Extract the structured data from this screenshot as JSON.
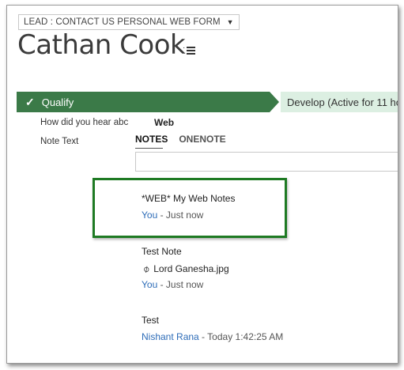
{
  "header": {
    "form_selector": "LEAD : CONTACT US PERSONAL WEB FORM",
    "record_title": "Cathan Cook"
  },
  "process_bar": {
    "active_stage": "Qualify",
    "next_stage": "Develop (Active for 11 ho"
  },
  "fields": {
    "how_heard_label": "How did you hear abc",
    "how_heard_value": "Web",
    "note_text_label": "Note Text"
  },
  "tabs": {
    "notes": "NOTES",
    "onenote": "ONENOTE"
  },
  "notes": [
    {
      "title": "*WEB* My Web Notes",
      "author": "You",
      "separator": " - ",
      "time": "Just now"
    },
    {
      "title": "Test Note",
      "attachment": "Lord Ganesha.jpg",
      "author": "You",
      "separator": " - ",
      "time": "Just now"
    },
    {
      "title": "Test",
      "author": "Nishant Rana",
      "separator": " - ",
      "time": "Today 1:42:25 AM"
    }
  ],
  "colors": {
    "stage_active": "#3b7a48",
    "stage_next": "#dcefe2",
    "highlight_border": "#1e7a23",
    "link": "#2d6cb8"
  }
}
